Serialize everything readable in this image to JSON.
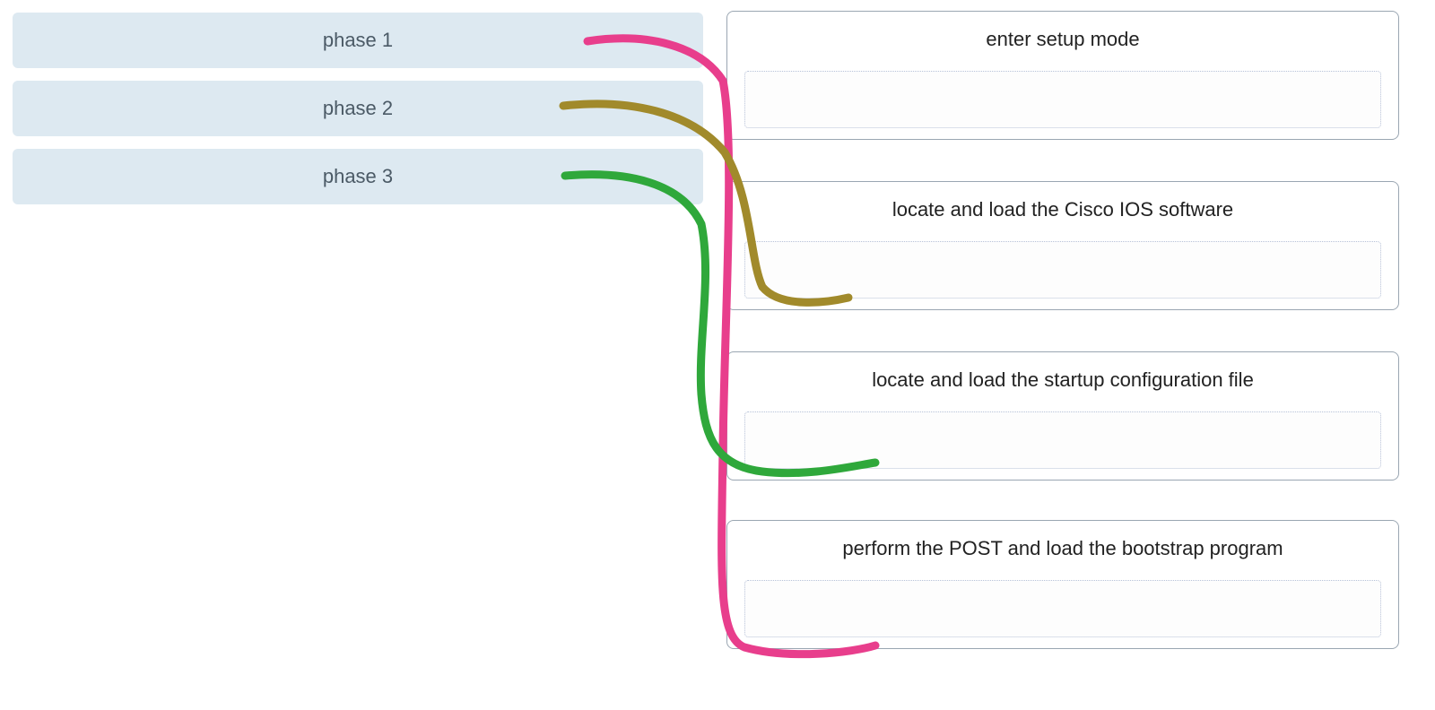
{
  "phases": [
    {
      "label": "phase 1"
    },
    {
      "label": "phase 2"
    },
    {
      "label": "phase 3"
    }
  ],
  "answers": [
    {
      "label": "enter setup mode"
    },
    {
      "label": "locate and load the Cisco IOS software"
    },
    {
      "label": "locate and load the startup configuration file"
    },
    {
      "label": "perform the POST and load the bootstrap program"
    }
  ],
  "connectors": [
    {
      "name": "pink",
      "color": "#e83e8c",
      "from_phase": 0,
      "to_answer": 3
    },
    {
      "name": "olive",
      "color": "#a18a2b",
      "from_phase": 1,
      "to_answer": 1
    },
    {
      "name": "green",
      "color": "#2fa83b",
      "from_phase": 2,
      "to_answer": 2
    }
  ]
}
